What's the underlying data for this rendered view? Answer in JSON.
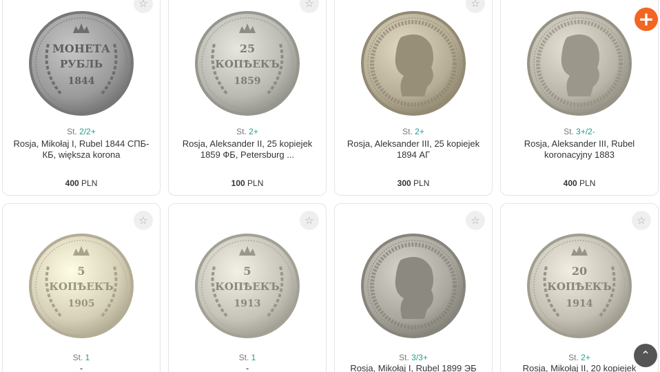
{
  "actions": {
    "add_icon": "plus-icon",
    "add_symbol": "+",
    "scroll_top_icon": "chevron-up-icon",
    "scroll_top_symbol": "⌃"
  },
  "colors": {
    "accent_orange": "#f26522",
    "grade_teal": "#1d9e8e",
    "scroll_top_bg": "#555555"
  },
  "favorite_symbol": "☆",
  "cards": [
    {
      "grade_prefix": "St. ",
      "grade": "2/2+",
      "title": "Rosja, Mikołaj I, Rubel 1844 СПБ-КБ, większa korona",
      "price": "400",
      "currency": "PLN",
      "coin": {
        "type": "text",
        "lines": [
          "МОНЕТА",
          "РУБЛЬ",
          "1844"
        ],
        "tone": "#9a9a9a"
      }
    },
    {
      "grade_prefix": "St. ",
      "grade": "2+",
      "title": "Rosja, Aleksander II, 25 kopiejek 1859 ФБ, Petersburg ...",
      "price": "100",
      "currency": "PLN",
      "coin": {
        "type": "text",
        "lines": [
          "25",
          "КОПѢЕКЪ",
          "1859"
        ],
        "tone": "#b9b9b2"
      }
    },
    {
      "grade_prefix": "St. ",
      "grade": "2+",
      "title": "Rosja, Aleksander III, 25 kopiejek 1894 АГ",
      "price": "300",
      "currency": "PLN",
      "coin": {
        "type": "portrait",
        "tone": "#b5ad95"
      }
    },
    {
      "grade_prefix": "St. ",
      "grade": "3+/2-",
      "title": "Rosja, Aleksander III, Rubel koronacyjny 1883",
      "price": "400",
      "currency": "PLN",
      "coin": {
        "type": "portrait",
        "tone": "#b9b5a8"
      }
    },
    {
      "grade_prefix": "St. ",
      "grade": "1",
      "title": "-",
      "coin": {
        "type": "text",
        "lines": [
          "5",
          "КОПѢЕКЪ",
          "1905"
        ],
        "tone": "#d6d0b8"
      }
    },
    {
      "grade_prefix": "St. ",
      "grade": "1",
      "title": "-",
      "coin": {
        "type": "text",
        "lines": [
          "5",
          "КОПѢЕКЪ",
          "1913"
        ],
        "tone": "#c6c3b8"
      }
    },
    {
      "grade_prefix": "St. ",
      "grade": "3/3+",
      "title": "Rosja, Mikołaj I, Rubel 1899 ЭБ",
      "coin": {
        "type": "portrait",
        "tone": "#a9a79e"
      }
    },
    {
      "grade_prefix": "St. ",
      "grade": "2+",
      "title": "Rosja, Mikołaj II, 20 kopiejek",
      "coin": {
        "type": "text",
        "lines": [
          "20",
          "КОПѢЕКЪ",
          "1914"
        ],
        "tone": "#c4c0b3"
      }
    }
  ]
}
